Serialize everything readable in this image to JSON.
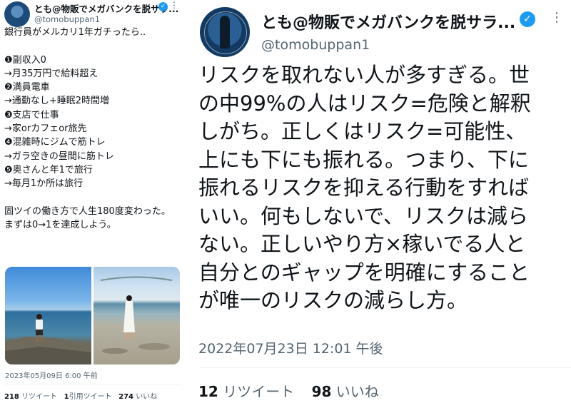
{
  "left_tweet": {
    "display_name": "とも@物販でメガバンクを脱サラ...",
    "verified_icon": "check",
    "handle": "@tomobuppan1",
    "body": "銀行員がメルカリ1年ガチったら..\n\n❶副収入0\n→月35万円で給料超え\n❷満員電車\n→通勤なし+睡眠2時間増\n❸支店で仕事\n→家orカフェor旅先\n❹混雑時にジムで筋トレ\n→ガラ空きの昼間に筋トレ\n❺奥さんと年1で旅行\n→毎月1か所は旅行\n\n固ツイの働き方で人生180度変わった。\nまずは0→1を達成しよう。",
    "timestamp": "2023年05月09日 6:00 午前",
    "retweets_count": "218",
    "retweets_label": "リツイート",
    "quotes_count": "1",
    "quotes_label": "引用ツイート",
    "likes_count": "274",
    "likes_label": "いいね"
  },
  "right_tweet": {
    "display_name": "とも@物販でメガバンクを脱サラ...",
    "verified_icon": "check",
    "handle": "@tomobuppan1",
    "body": "リスクを取れない人が多すぎる。世\nの中99%の人はリスク=危険と解釈\nしがち。正しくはリスク=可能性、\n上にも下にも振れる。つまり、下に\n振れるリスクを抑える行動をすれば\nいい。何もしないで、リスクは減ら\nない。正しいやり方×稼いでる人と\n自分とのギャップを明確にすること\nが唯一のリスクの減らし方。",
    "timestamp": "2022年07月23日 12:01 午後",
    "retweets_count": "12",
    "retweets_label": "リツイート",
    "likes_count": "98",
    "likes_label": "いいね"
  },
  "icons": {
    "more": "⋮",
    "verified": "✓"
  },
  "colors": {
    "verified_blue": "#1d9bf0",
    "secondary_text": "#536471",
    "primary_text": "#0f1419"
  }
}
